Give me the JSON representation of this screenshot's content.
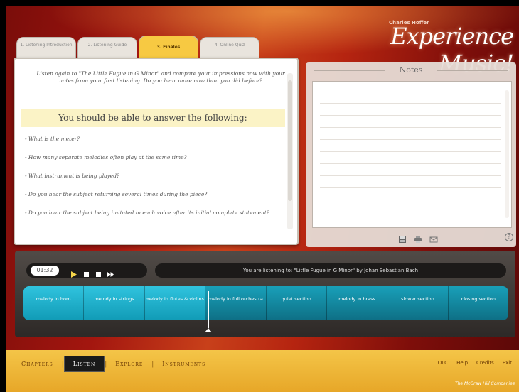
{
  "brand": {
    "small": "Charles Hoffer",
    "title": "Experience Music!"
  },
  "tabs": [
    {
      "label": "1. Listening Introduction"
    },
    {
      "label": "2. Listening Guide"
    },
    {
      "label": "3. Finales"
    },
    {
      "label": "4. Online Quiz"
    }
  ],
  "left": {
    "intro": "Listen again to \"The Little Fugue in G Minor\" and compare your impressions now with your notes from your first listening. Do you hear more now than you did before?",
    "banner": "You should be able to answer the following:",
    "questions": [
      "- What is the meter?",
      "- How many separate melodies often play at the same time?",
      "- What instrument is being played?",
      "- Do you hear the subject returning several times during the piece?",
      "- Do you hear the subject being imitated in each voice after its initial complete statement?"
    ]
  },
  "notes": {
    "title": "Notes",
    "icons": [
      "save-icon",
      "print-icon",
      "email-icon"
    ],
    "help": "?"
  },
  "player": {
    "time": "01:32",
    "now_playing": "You are listening to: \"Little Fugue in G Minor\" by Johan Sebastian Bach",
    "sections": [
      "melody in horn",
      "melody in strings",
      "melody in flutes & violins",
      "melody in full orchestra",
      "quiet section",
      "melody in brass",
      "slower section",
      "closing section"
    ],
    "played_count": 3
  },
  "bottom": {
    "nav": [
      "Chapters",
      "Listen",
      "Explore",
      "Instruments"
    ],
    "active": "Listen",
    "links": [
      "OLC",
      "Help",
      "Credits",
      "Exit"
    ],
    "publisher": "The McGraw Hill Companies"
  },
  "colors": {
    "accent_tab": "#f7c942",
    "section_bar": "#19a0b9",
    "nav_bg": "#f4c548"
  }
}
